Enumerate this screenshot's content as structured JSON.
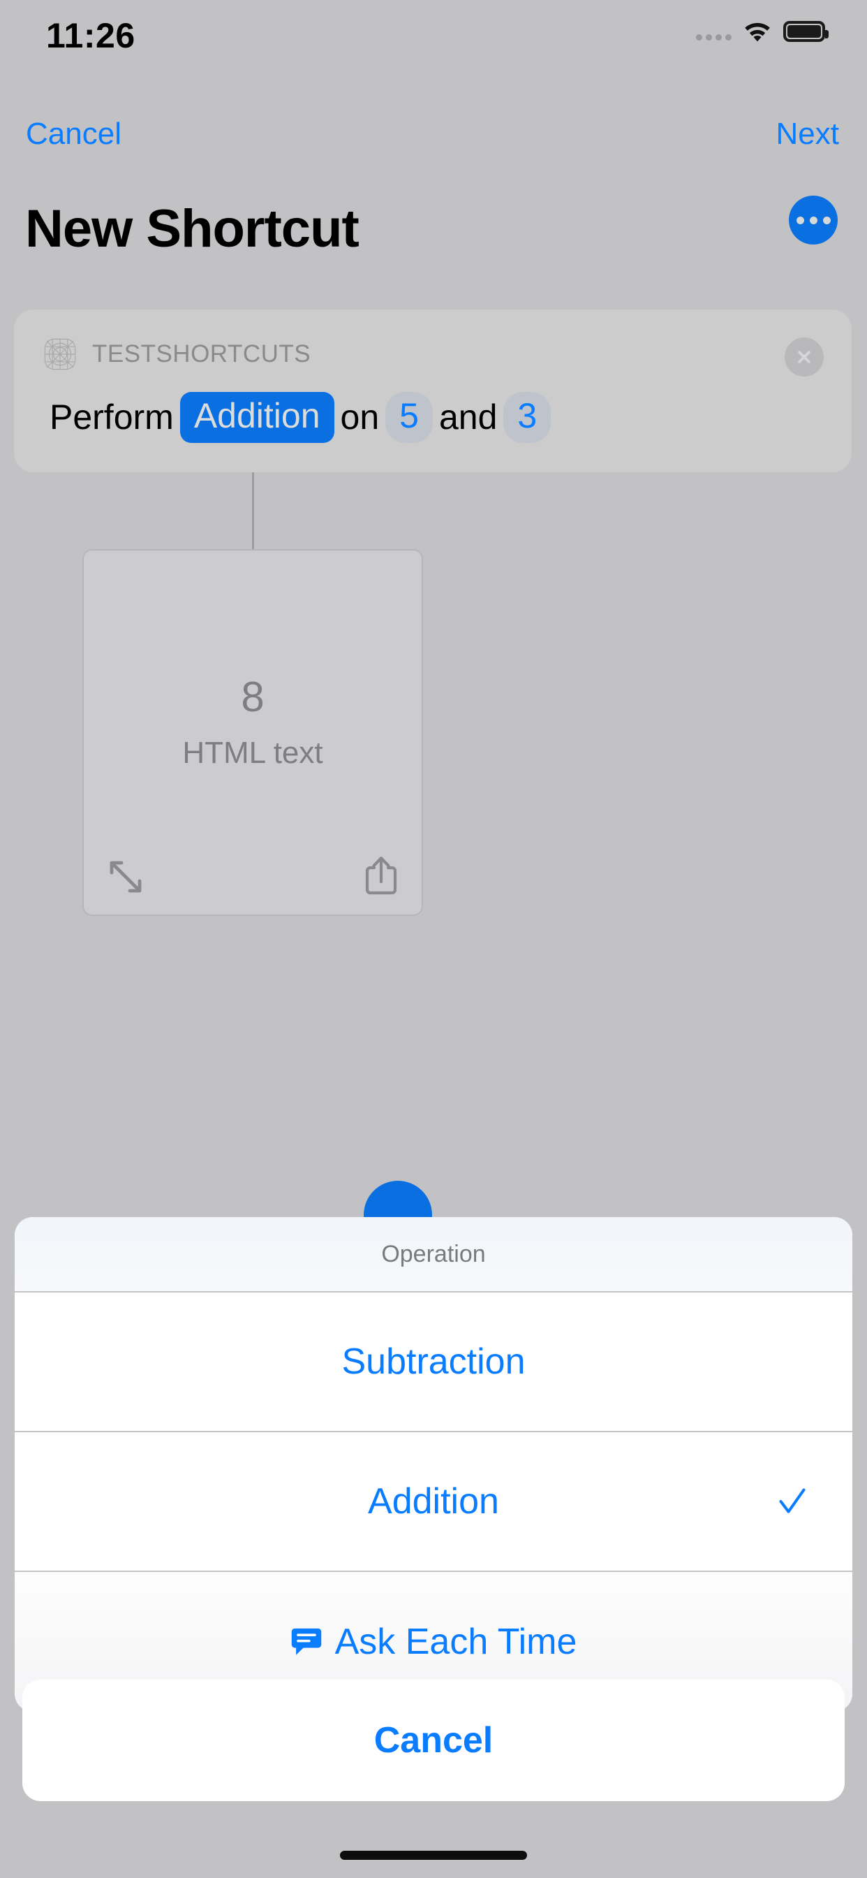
{
  "status_bar": {
    "time": "11:26",
    "signal_icon": "signal-dots-icon",
    "wifi_icon": "wifi-icon",
    "battery_icon": "battery-full-icon"
  },
  "nav": {
    "cancel_label": "Cancel",
    "next_label": "Next",
    "title": "New Shortcut",
    "more_icon": "more-ellipsis-icon"
  },
  "action_card": {
    "app_icon": "placeholder-app-icon",
    "app_name": "TESTSHORTCUTS",
    "close_icon": "close-circle-icon",
    "sentence": {
      "prefix": "Perform",
      "operation_pill": "Addition",
      "middle": "on",
      "operand_a": "5",
      "conjunction": "and",
      "operand_b": "3"
    }
  },
  "preview": {
    "value": "8",
    "label": "HTML text",
    "expand_icon": "expand-arrows-icon",
    "share_icon": "share-icon"
  },
  "run_button": {
    "name": "run-shortcut-button"
  },
  "action_sheet": {
    "title": "Operation",
    "options": [
      {
        "label": "Subtraction",
        "checked": false,
        "icon": null
      },
      {
        "label": "Addition",
        "checked": true,
        "icon": null
      },
      {
        "label": "Ask Each Time",
        "checked": false,
        "icon": "message-bubble-icon"
      }
    ],
    "cancel_label": "Cancel"
  },
  "colors": {
    "accent_blue": "#0a7cff",
    "pill_blue": "#0a6fe0",
    "background_gray": "#c2c2c4",
    "card_gray": "#cccccd",
    "muted_text": "#7e7e81"
  }
}
